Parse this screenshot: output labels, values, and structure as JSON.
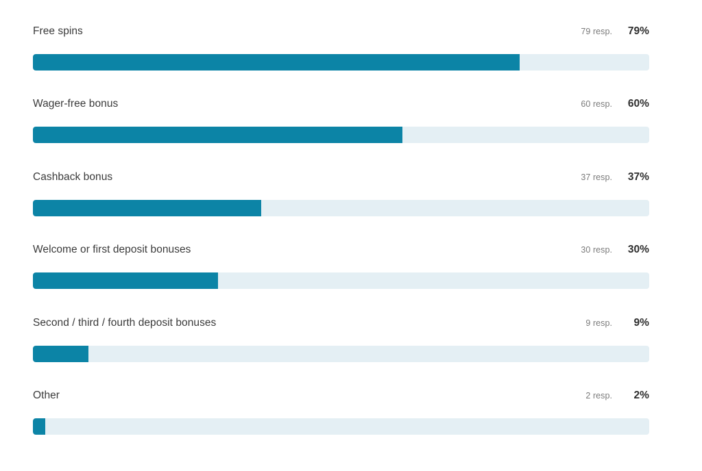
{
  "chart_data": {
    "type": "bar",
    "orientation": "horizontal",
    "title": "",
    "xlabel": "",
    "ylabel": "",
    "xlim": [
      0,
      100
    ],
    "grid": false,
    "legend": null,
    "value_unit": "%",
    "response_suffix": "resp.",
    "categories": [
      "Free spins",
      "Wager-free bonus",
      "Cashback bonus",
      "Welcome or first deposit bonuses",
      "Second / third / fourth deposit bonuses",
      "Other"
    ],
    "values": [
      79,
      60,
      37,
      30,
      9,
      2
    ],
    "responses": [
      79,
      60,
      37,
      30,
      9,
      2
    ],
    "colors": {
      "bar_fill": "#0c84a6",
      "bar_track": "#e4eff4",
      "label_text": "#3a3a3a",
      "response_text": "#7b7b7b",
      "percent_text": "#2e2e2e",
      "background": "#ffffff"
    }
  },
  "rows": [
    {
      "label": "Free spins",
      "responses": "79 resp.",
      "percent": "79%",
      "value": 79
    },
    {
      "label": "Wager-free bonus",
      "responses": "60 resp.",
      "percent": "60%",
      "value": 60
    },
    {
      "label": "Cashback bonus",
      "responses": "37 resp.",
      "percent": "37%",
      "value": 37
    },
    {
      "label": "Welcome or first deposit bonuses",
      "responses": "30 resp.",
      "percent": "30%",
      "value": 30
    },
    {
      "label": "Second / third / fourth deposit bonuses",
      "responses": "9 resp.",
      "percent": "9%",
      "value": 9
    },
    {
      "label": "Other",
      "responses": "2 resp.",
      "percent": "2%",
      "value": 2
    }
  ]
}
